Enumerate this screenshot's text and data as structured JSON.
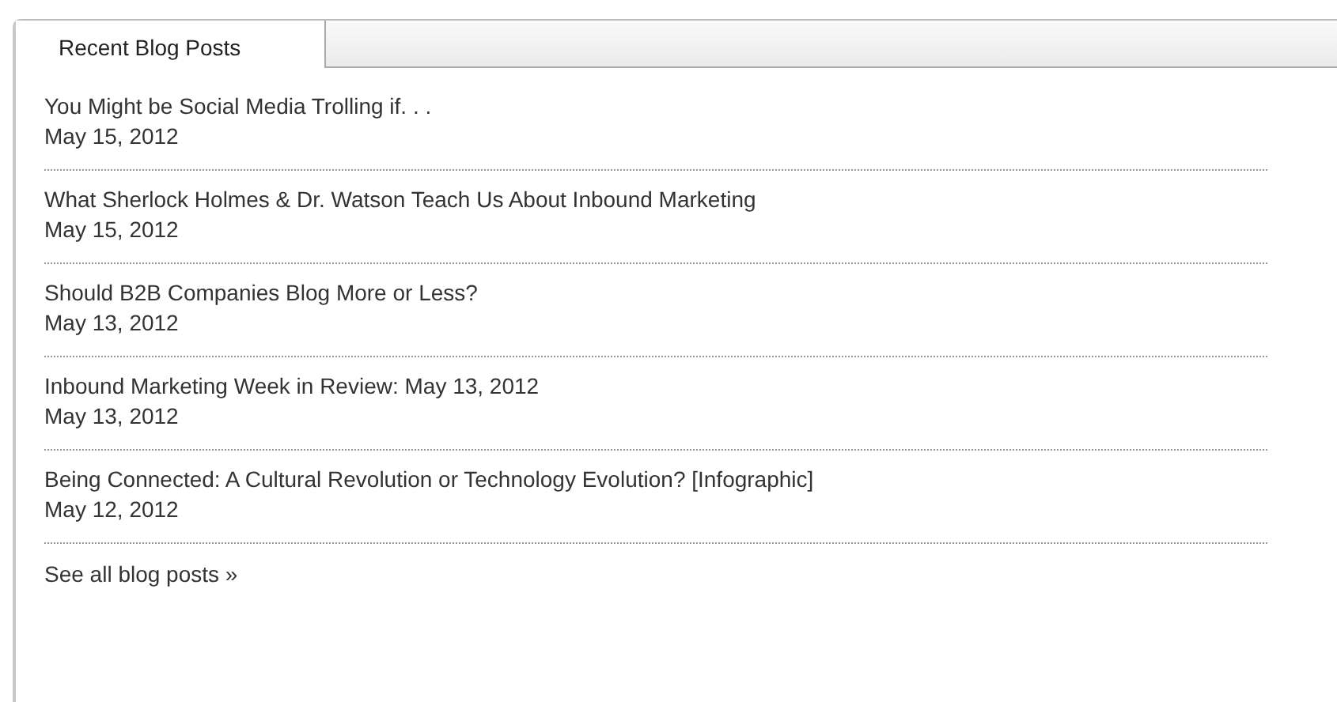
{
  "tabs": [
    {
      "label": "Recent Blog Posts",
      "selected": true
    }
  ],
  "posts": [
    {
      "title": "You Might be Social Media Trolling if. . .",
      "date": "May 15, 2012"
    },
    {
      "title": "What Sherlock Holmes & Dr. Watson Teach Us About Inbound Marketing",
      "date": "May 15, 2012"
    },
    {
      "title": "Should B2B Companies Blog More or Less?",
      "date": "May 13, 2012"
    },
    {
      "title": "Inbound Marketing Week in Review: May 13, 2012",
      "date": "May 13, 2012"
    },
    {
      "title": "Being Connected: A Cultural Revolution or Technology Evolution? [Infographic]",
      "date": "May 12, 2012"
    }
  ],
  "footer_link": "See all blog posts »"
}
